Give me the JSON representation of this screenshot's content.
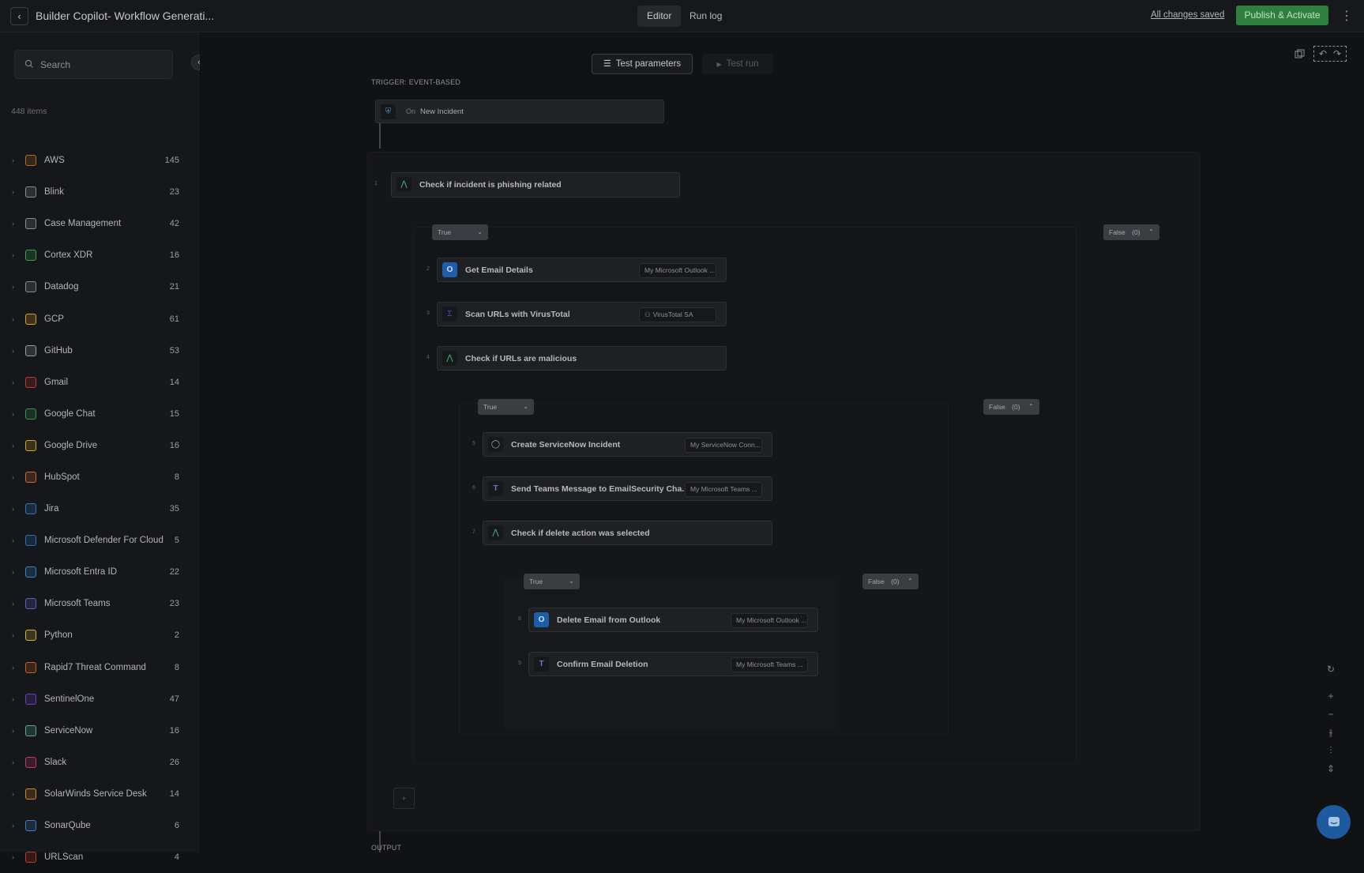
{
  "header": {
    "back": "‹",
    "title": "Builder Copilot- Workflow Generati...",
    "tabs": [
      {
        "label": "Editor"
      },
      {
        "label": "Run log"
      }
    ],
    "saved": "All changes saved",
    "publish": "Publish & Activate",
    "menu": "⋮"
  },
  "sidebar": {
    "search_placeholder": "Search",
    "item_count": "448 items",
    "items": [
      {
        "name": "AWS",
        "count": "145",
        "color": "#b06d2a"
      },
      {
        "name": "Blink",
        "count": "23",
        "color": "#8b8d93"
      },
      {
        "name": "Case Management",
        "count": "42",
        "color": "#8b8d93"
      },
      {
        "name": "Cortex XDR",
        "count": "16",
        "color": "#3aa44d"
      },
      {
        "name": "Datadog",
        "count": "21",
        "color": "#8a8c92"
      },
      {
        "name": "GCP",
        "count": "61",
        "color": "#d9a12b"
      },
      {
        "name": "GitHub",
        "count": "53",
        "color": "#9a9ca2"
      },
      {
        "name": "Gmail",
        "count": "14",
        "color": "#c0392b"
      },
      {
        "name": "Google Chat",
        "count": "15",
        "color": "#2f9a4f"
      },
      {
        "name": "Google Drive",
        "count": "16",
        "color": "#d3a22a"
      },
      {
        "name": "HubSpot",
        "count": "8",
        "color": "#d16a2e"
      },
      {
        "name": "Jira",
        "count": "35",
        "color": "#2f72c6"
      },
      {
        "name": "Microsoft Defender For Cloud",
        "count": "5",
        "color": "#2a6fc1"
      },
      {
        "name": "Microsoft Entra ID",
        "count": "22",
        "color": "#2e86d1"
      },
      {
        "name": "Microsoft Teams",
        "count": "23",
        "color": "#5b5fc7"
      },
      {
        "name": "Python",
        "count": "2",
        "color": "#d2b33a"
      },
      {
        "name": "Rapid7 Threat Command",
        "count": "8",
        "color": "#c9601f"
      },
      {
        "name": "SentinelOne",
        "count": "47",
        "color": "#6a3fc4"
      },
      {
        "name": "ServiceNow",
        "count": "16",
        "color": "#5fa88d"
      },
      {
        "name": "Slack",
        "count": "26",
        "color": "#c23a6b"
      },
      {
        "name": "SolarWinds Service Desk",
        "count": "14",
        "color": "#d0872a"
      },
      {
        "name": "SonarQube",
        "count": "6",
        "color": "#3b7fc2"
      },
      {
        "name": "URLScan",
        "count": "4",
        "color": "#c0392b"
      }
    ]
  },
  "toolbar": {
    "test_params": "Test parameters",
    "test_run": "Test run"
  },
  "flow": {
    "trigger_label": "TRIGGER: EVENT-BASED",
    "trigger_on": "On",
    "trigger_event": "New Incident",
    "output_label": "OUTPUT",
    "nodes": [
      {
        "num": "1",
        "label": "Check if incident is phishing related"
      },
      {
        "num": "2",
        "label": "Get Email Details",
        "conn": "My Microsoft Outlook ..."
      },
      {
        "num": "3",
        "label": "Scan URLs with VirusTotal",
        "conn": "VirusTotal SA"
      },
      {
        "num": "4",
        "label": "Check if URLs are malicious"
      },
      {
        "num": "5",
        "label": "Create ServiceNow Incident",
        "conn": "My ServiceNow Conn..."
      },
      {
        "num": "6",
        "label": "Send Teams Message to EmailSecurity Cha...",
        "conn": "My Microsoft Teams ..."
      },
      {
        "num": "7",
        "label": "Check if delete action was selected"
      },
      {
        "num": "8",
        "label": "Delete Email from Outlook",
        "conn": "My Microsoft Outlook ..."
      },
      {
        "num": "9",
        "label": "Confirm Email Deletion",
        "conn": "My Microsoft Teams ..."
      }
    ],
    "branches": {
      "true": "True",
      "false": "False",
      "false_count": "(0)"
    }
  }
}
